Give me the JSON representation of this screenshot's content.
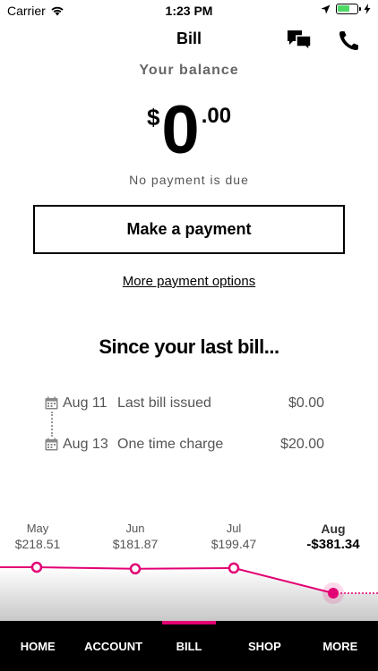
{
  "status_bar": {
    "carrier": "Carrier",
    "time": "1:23 PM"
  },
  "header": {
    "title": "Bill",
    "icons": [
      "chat-icon",
      "phone-icon"
    ]
  },
  "balance": {
    "label": "Your balance",
    "currency": "$",
    "dollars": "0",
    "cents": ".00",
    "status": "No payment is due"
  },
  "actions": {
    "make_payment": "Make a payment",
    "more_options": "More payment options"
  },
  "since_last_bill": {
    "title": "Since your last bill...",
    "items": [
      {
        "date": "Aug 11",
        "description": "Last bill issued",
        "amount": "$0.00"
      },
      {
        "date": "Aug 13",
        "description": "One time charge",
        "amount": "$20.00"
      }
    ]
  },
  "chart_data": {
    "type": "line",
    "categories": [
      "May",
      "Jun",
      "Jul",
      "Aug"
    ],
    "labels": [
      "$218.51",
      "$181.87",
      "$199.47",
      "-$381.34"
    ],
    "values": [
      218.51,
      181.87,
      199.47,
      -381.34
    ],
    "current_index": 3,
    "accent": "#e20074"
  },
  "tabs": [
    {
      "label": "HOME",
      "active": false
    },
    {
      "label": "ACCOUNT",
      "active": false
    },
    {
      "label": "BILL",
      "active": true
    },
    {
      "label": "SHOP",
      "active": false
    },
    {
      "label": "MORE",
      "active": false
    }
  ],
  "colors": {
    "accent": "#e20074",
    "tab_bar": "#000000",
    "battery": "#4cd964"
  }
}
